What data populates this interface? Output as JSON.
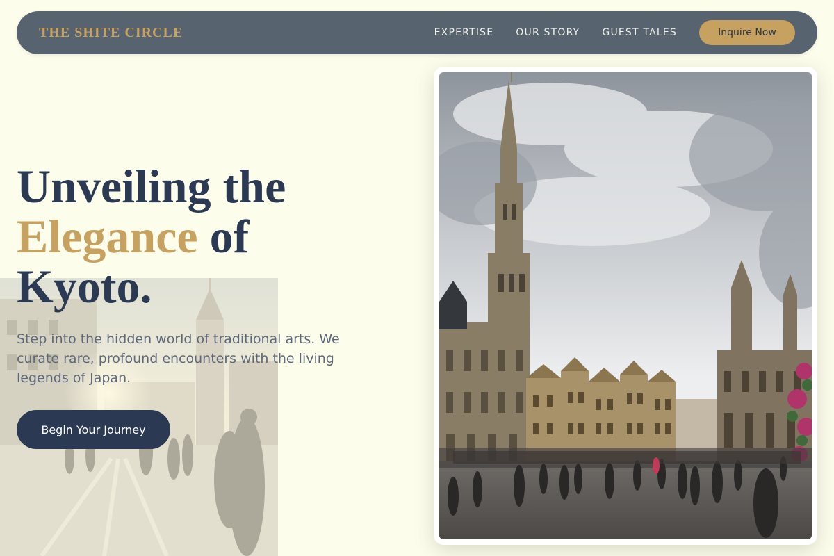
{
  "brand": {
    "name": "THE SHITE CIRCLE"
  },
  "nav": {
    "links": [
      "EXPERTISE",
      "OUR STORY",
      "GUEST TALES"
    ],
    "cta_label": "Inquire Now"
  },
  "hero": {
    "title_line1": "Unveiling the",
    "title_accent": "Elegance",
    "title_line2_rest": " of",
    "title_line3": "Kyoto.",
    "subtitle": "Step into the hidden world of traditional arts. We curate rare, profound encounters with the living legends of Japan.",
    "cta_label": "Begin Your Journey"
  },
  "colors": {
    "background": "#fdfdec",
    "nav_bg": "#57636f",
    "accent_gold": "#c6a15f",
    "navy": "#2b3a52"
  }
}
